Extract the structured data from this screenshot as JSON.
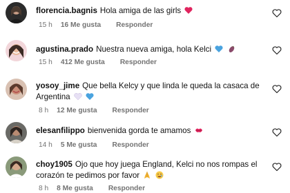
{
  "comments": [
    {
      "username": "florencia.bagnis",
      "text": "Hola amiga de las girls",
      "emoji": "red-heart",
      "time": "15 h",
      "likes": "16 Me gusta",
      "reply": "Responder"
    },
    {
      "username": "agustina.prado",
      "text": "Nuestra nueva amiga, hola Kelci",
      "emoji": "blue-heart, eggplant",
      "time": "15 h",
      "likes": "412 Me gusta",
      "reply": "Responder"
    },
    {
      "username": "yosoy_jime",
      "text": "Que bella Kelcy y que linda le queda la casaca de Argentina",
      "emoji": "white-heart, blue-heart",
      "time": "8 h",
      "likes": "12 Me gusta",
      "reply": "Responder"
    },
    {
      "username": "elesanfilippo",
      "text": "bienvenida gorda te amamos",
      "emoji": "kiss-mark",
      "time": "14 h",
      "likes": "5 Me gusta",
      "reply": "Responder"
    },
    {
      "username": "choy1905",
      "text": "Ojo que hoy juega England, Kelci no nos rompas el corazón te pedimos por favor",
      "emoji": "folded-hands, smiling-face-with-tear",
      "time": "8 h",
      "likes": "8 Me gusta",
      "reply": "Responder"
    }
  ],
  "colors": {
    "meta": "#737373",
    "text": "#111111",
    "heart_outline": "#262626",
    "red_heart": "#e0245e",
    "blue_heart": "#4aa3df",
    "white_heart": "#e7e0f4"
  }
}
